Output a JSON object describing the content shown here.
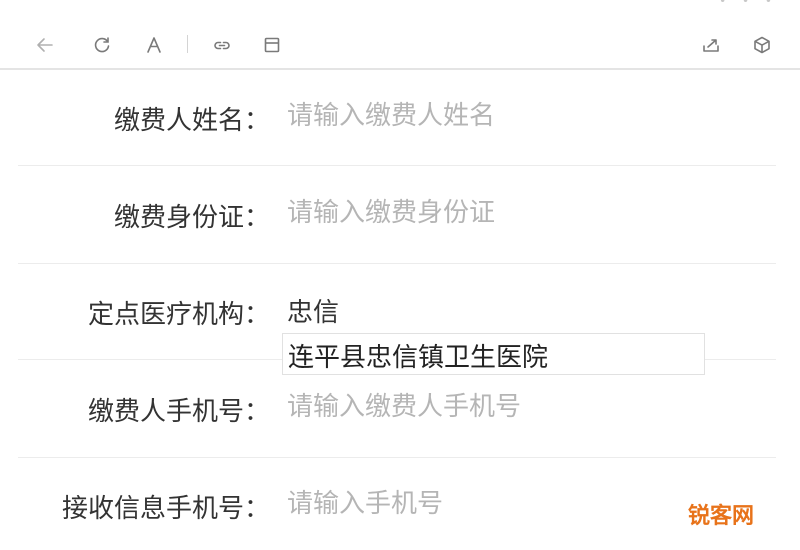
{
  "toolbar": {
    "icons": [
      "back-arrow-icon",
      "refresh-icon",
      "font-size-icon",
      "link-icon",
      "layout-icon",
      "share-icon",
      "cube-icon"
    ]
  },
  "form": {
    "payer_name": {
      "label": "缴费人姓名：",
      "placeholder": "请输入缴费人姓名"
    },
    "payer_id": {
      "label": "缴费身份证：",
      "placeholder": "请输入缴费身份证"
    },
    "institution": {
      "label": "定点医疗机构：",
      "value": "忠信"
    },
    "payer_phone": {
      "label": "缴费人手机号：",
      "placeholder": "请输入缴费人手机号"
    },
    "notify_phone": {
      "label": "接收信息手机号：",
      "placeholder": "请输入手机号"
    }
  },
  "suggestions": [
    "连平县忠信镇卫生医院"
  ],
  "watermark": "锐客网",
  "colors": {
    "placeholder": "#b5b5b5",
    "text": "#333333",
    "watermark": "#e8731a"
  }
}
